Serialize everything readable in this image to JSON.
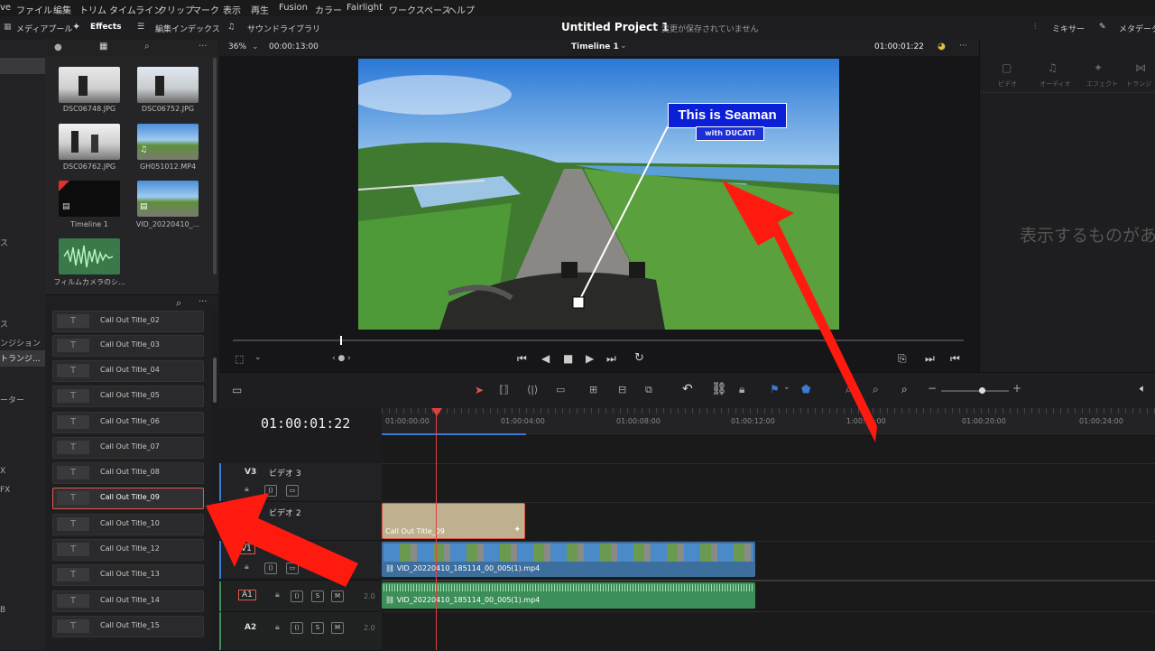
{
  "menu": [
    "ve",
    "ファイル",
    "編集",
    "トリム",
    "タイムライン",
    "クリップ",
    "マーク",
    "表示",
    "再生",
    "Fusion",
    "カラー",
    "Fairlight",
    "ワークスペース",
    "ヘルプ"
  ],
  "toolbar": {
    "media_pool": "メディアプール",
    "effects": "Effects",
    "edit_index": "編集インデックス",
    "sound_library": "サウンドライブラリ",
    "project_title": "Untitled Project 1",
    "save_status": "変更が保存されていません",
    "mixer": "ミキサー",
    "metadata": "メタデータ"
  },
  "viewer": {
    "zoom": "36%",
    "duration": "00:00:13:00",
    "timeline_name": "Timeline 1",
    "timecode": "01:00:01:22",
    "title_text": "This is Seaman",
    "subtitle_text": "with DUCATI"
  },
  "media": [
    {
      "name": "DSC06748.JPG"
    },
    {
      "name": "DSC06752.JPG"
    },
    {
      "name": "DSC06762.JPG"
    },
    {
      "name": "GH051012.MP4"
    },
    {
      "name": "Timeline 1"
    },
    {
      "name": "VID_20220410_..."
    },
    {
      "name": "フィルムカメラのシ..."
    }
  ],
  "left_labels": [
    "ス",
    "ンジション",
    "トランジ...",
    "ーター",
    "X",
    "FX",
    "B"
  ],
  "effects": [
    "Call Out Title_02",
    "Call Out Title_03",
    "Call Out Title_04",
    "Call Out Title_05",
    "Call Out Title_06",
    "Call Out Title_07",
    "Call Out Title_08",
    "Call Out Title_09",
    "Call Out Title_10",
    "Call Out Title_12",
    "Call Out Title_13",
    "Call Out Title_14",
    "Call Out Title_15"
  ],
  "selected_effect": "Call Out Title_09",
  "inspector": {
    "tabs": [
      "ビデオ",
      "オーディオ",
      "エフェクト",
      "トランジ"
    ],
    "empty_text": "表示するものがあ"
  },
  "timeline": {
    "timecode": "01:00:01:22",
    "ruler": [
      "01:00:00:00",
      "01:00:04:00",
      "01:00:08:00",
      "01:00:12:00",
      "1:00:16:00",
      "01:00:20:00",
      "01:00:24:00"
    ],
    "tracks": [
      {
        "id": "V3",
        "name": "ビデオ 3"
      },
      {
        "id": "V2",
        "name": "ビデオ 2"
      },
      {
        "id": "V1",
        "name": ""
      },
      {
        "id": "A1",
        "name": "",
        "level": "2.0"
      },
      {
        "id": "A2",
        "name": "",
        "level": "2.0"
      }
    ],
    "clips": {
      "title": "Call Out Title_09",
      "video": "VID_20220410_185114_00_005(1).mp4",
      "audio": "VID_20220410_185114_00_005(1).mp4"
    }
  },
  "colors": {
    "accent": "#e25a4a",
    "arrow": "#ff0000",
    "title_bg": "#0a1fd6",
    "video_clip": "#3d6f9e",
    "audio_clip": "#3d8f5a",
    "title_clip": "#bfb190"
  }
}
